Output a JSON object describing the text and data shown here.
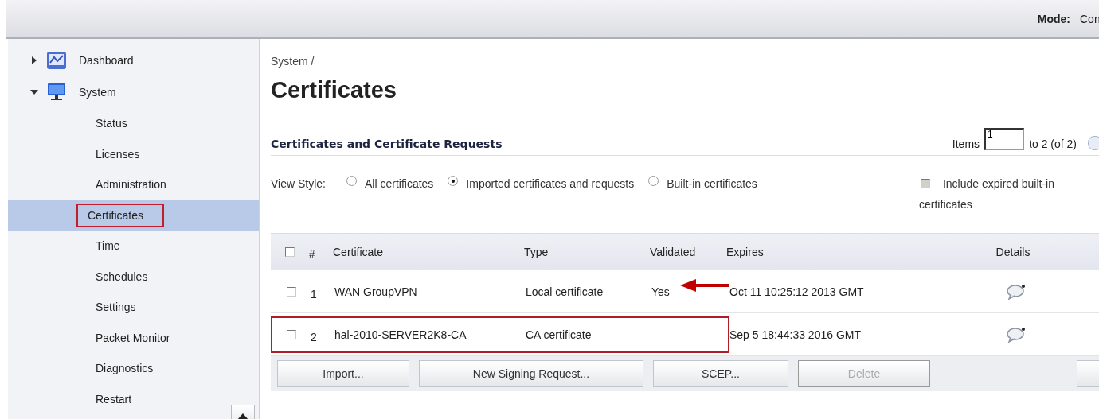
{
  "top_bar": {
    "mode_label": "Mode:",
    "mode_value": "Con"
  },
  "sidebar": {
    "items": [
      {
        "label": "Dashboard",
        "expanded": false
      },
      {
        "label": "System",
        "expanded": true,
        "children": [
          {
            "label": "Status",
            "selected": false,
            "marked": false
          },
          {
            "label": "Licenses",
            "selected": false,
            "marked": false
          },
          {
            "label": "Administration",
            "selected": false,
            "marked": false
          },
          {
            "label": "Certificates",
            "selected": true,
            "marked": true
          },
          {
            "label": "Time",
            "selected": false,
            "marked": false
          },
          {
            "label": "Schedules",
            "selected": false,
            "marked": false
          },
          {
            "label": "Settings",
            "selected": false,
            "marked": false
          },
          {
            "label": "Packet Monitor",
            "selected": false,
            "marked": false
          },
          {
            "label": "Diagnostics",
            "selected": false,
            "marked": false
          },
          {
            "label": "Restart",
            "selected": false,
            "marked": false
          }
        ]
      }
    ]
  },
  "breadcrumb": "System /",
  "title": "Certificates",
  "section": {
    "title": "Certificates and Certificate Requests",
    "items_label": "Items",
    "items_value": "1",
    "items_range": "to 2 (of 2)"
  },
  "view_style": {
    "label": "View Style:",
    "options": [
      {
        "label": "All certificates",
        "selected": false
      },
      {
        "label": "Imported certificates and requests",
        "selected": true
      },
      {
        "label": "Built-in certificates",
        "selected": false
      }
    ],
    "include_expired": {
      "label": "Include expired built-in certificates",
      "checked": false,
      "disabled": true
    }
  },
  "table": {
    "select_all_checked": false,
    "columns": [
      "#",
      "Certificate",
      "Type",
      "Validated",
      "Expires",
      "Details"
    ],
    "rows": [
      {
        "checked": false,
        "number": "1",
        "certificate": "WAN GroupVPN",
        "type": "Local certificate",
        "validated": "Yes",
        "expires": "Oct 11 10:25:12 2013 GMT",
        "marked": false,
        "arrow": true
      },
      {
        "checked": false,
        "number": "2",
        "certificate": "hal-2010-SERVER2K8-CA",
        "type": "CA certificate",
        "expires": "Sep 5 18:44:33 2016 GMT",
        "marked": true,
        "arrow": false
      }
    ]
  },
  "buttons": [
    {
      "label": "Import...",
      "disabled": false
    },
    {
      "label": "New Signing Request...",
      "disabled": false
    },
    {
      "label": "SCEP...",
      "disabled": false
    },
    {
      "label": "Delete",
      "disabled": true
    }
  ]
}
